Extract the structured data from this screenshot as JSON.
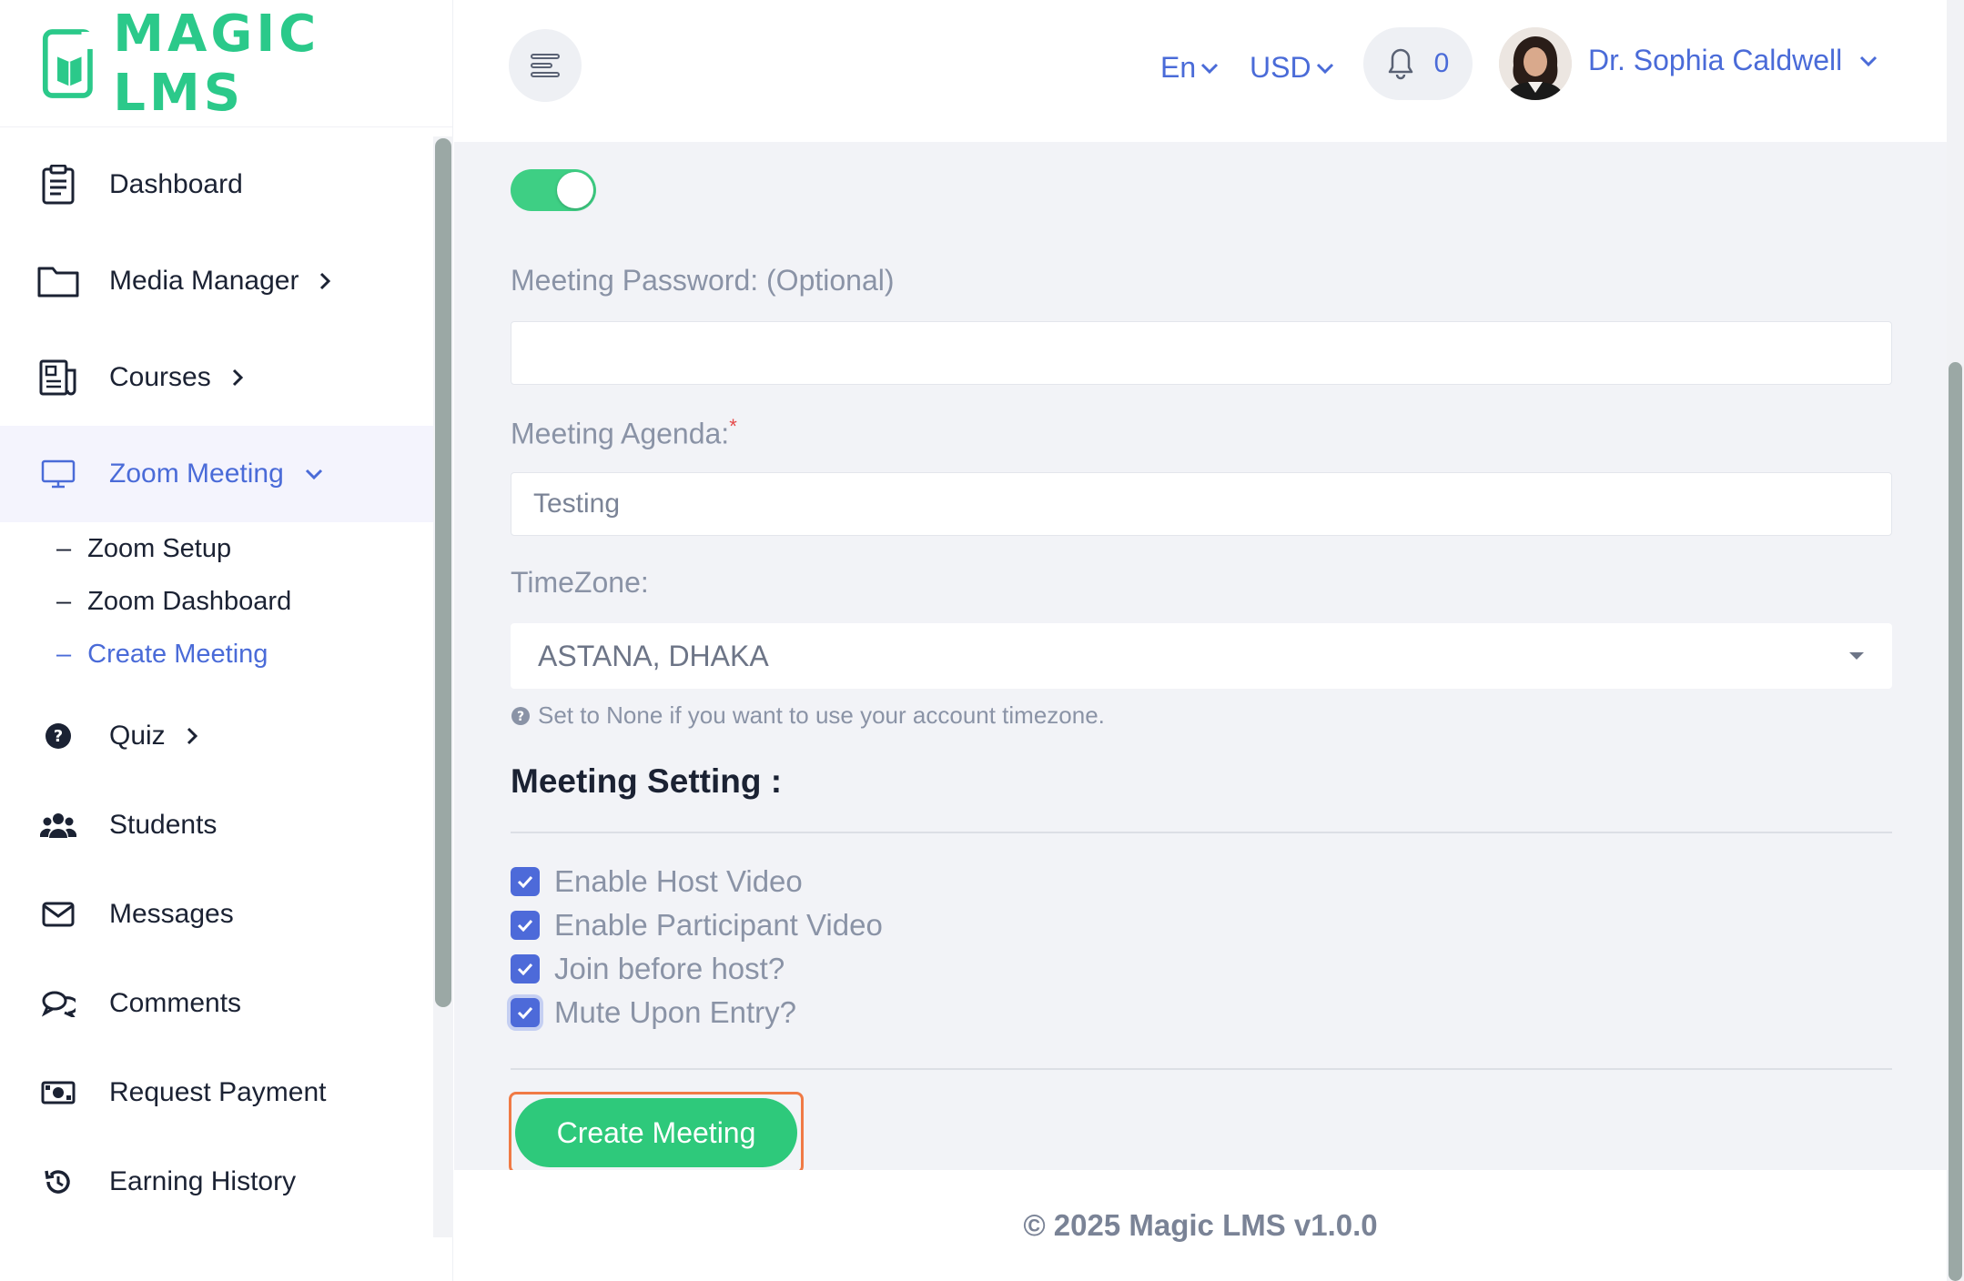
{
  "brand": {
    "name": "MAGIC LMS",
    "color": "#2bc98a"
  },
  "sidebar": {
    "items": [
      {
        "label": "Dashboard",
        "icon": "clipboard-icon"
      },
      {
        "label": "Media Manager",
        "icon": "folder-icon"
      },
      {
        "label": "Courses",
        "icon": "newspaper-icon"
      },
      {
        "label": "Zoom Meeting",
        "icon": "monitor-icon"
      },
      {
        "label": "Quiz",
        "icon": "question-circle-icon"
      },
      {
        "label": "Students",
        "icon": "users-icon"
      },
      {
        "label": "Messages",
        "icon": "envelope-icon"
      },
      {
        "label": "Comments",
        "icon": "comments-icon"
      },
      {
        "label": "Request Payment",
        "icon": "money-bill-icon"
      },
      {
        "label": "Earning History",
        "icon": "history-icon"
      }
    ],
    "zoom_sub": [
      {
        "label": "Zoom Setup"
      },
      {
        "label": "Zoom Dashboard"
      },
      {
        "label": "Create Meeting"
      }
    ],
    "dash": "–"
  },
  "header": {
    "language": "En",
    "currency": "USD",
    "notifications": "0",
    "user_name": "Dr. Sophia Caldwell"
  },
  "form": {
    "password_label": "Meeting Password: (Optional)",
    "password_value": "",
    "agenda_label": "Meeting Agenda:",
    "required_mark": "*",
    "agenda_value": "Testing",
    "timezone_label": "TimeZone:",
    "timezone_value": "ASTANA, DHAKA",
    "timezone_hint": "Set to None if you want to use your account timezone.",
    "settings_title": "Meeting Setting :",
    "options": [
      {
        "label": "Enable Host Video",
        "checked": true
      },
      {
        "label": "Enable Participant Video",
        "checked": true
      },
      {
        "label": "Join before host?",
        "checked": true
      },
      {
        "label": "Mute Upon Entry?",
        "checked": true
      }
    ],
    "submit_label": "Create Meeting"
  },
  "footer": {
    "copyright": "© 2025 Magic LMS v1.0.0"
  },
  "colors": {
    "accent": "#4a6bd8",
    "primary_button": "#2ec97b",
    "toggle_on": "#3ecf84",
    "highlight_outline": "#f07a45"
  }
}
